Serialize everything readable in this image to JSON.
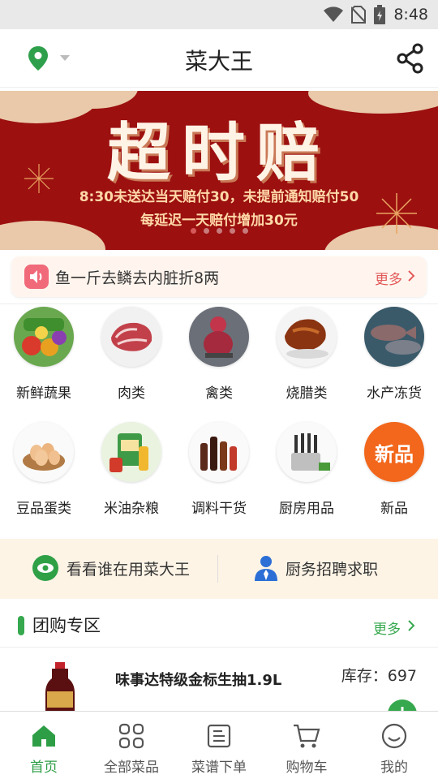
{
  "status_bar": {
    "time": "8:48"
  },
  "header": {
    "title": "菜大王"
  },
  "banner": {
    "headline": "超时赔",
    "line1": "8:30未送达当天赔付30，未提前通知赔付50",
    "line2": "每延迟一天赔付增加30元",
    "slide_count": 5,
    "active_slide": 0
  },
  "notice": {
    "text": "鱼一斤去鳞去内脏折8两",
    "more_label": "更多"
  },
  "categories": [
    {
      "label": "新鲜蔬果",
      "icon": "vegetables-image"
    },
    {
      "label": "肉类",
      "icon": "meat-image"
    },
    {
      "label": "禽类",
      "icon": "poultry-image"
    },
    {
      "label": "烧腊类",
      "icon": "roast-meat-image"
    },
    {
      "label": "水产冻货",
      "icon": "seafood-image"
    },
    {
      "label": "豆品蛋类",
      "icon": "eggs-image"
    },
    {
      "label": "米油杂粮",
      "icon": "rice-oil-image"
    },
    {
      "label": "调料干货",
      "icon": "seasoning-image"
    },
    {
      "label": "厨房用品",
      "icon": "kitchenware-image"
    },
    {
      "label": "新品",
      "icon": "new-product-badge",
      "badge_text": "新品"
    }
  ],
  "promo": {
    "left_label": "看看谁在用菜大王",
    "right_label": "厨务招聘求职"
  },
  "group_buy": {
    "title": "团购专区",
    "more_label": "更多",
    "product": {
      "name": "味事达特级金标生抽1.9L",
      "stock": "库存：697"
    }
  },
  "tabs": [
    {
      "label": "首页",
      "icon": "home-icon",
      "active": true
    },
    {
      "label": "全部菜品",
      "icon": "grid-icon",
      "active": false
    },
    {
      "label": "菜谱下单",
      "icon": "recipe-icon",
      "active": false
    },
    {
      "label": "购物车",
      "icon": "cart-icon",
      "active": false
    },
    {
      "label": "我的",
      "icon": "profile-icon",
      "active": false
    }
  ],
  "colors": {
    "brand_green": "#36a84e",
    "banner_red": "#9c1010",
    "notice_more": "#e25a5a"
  }
}
